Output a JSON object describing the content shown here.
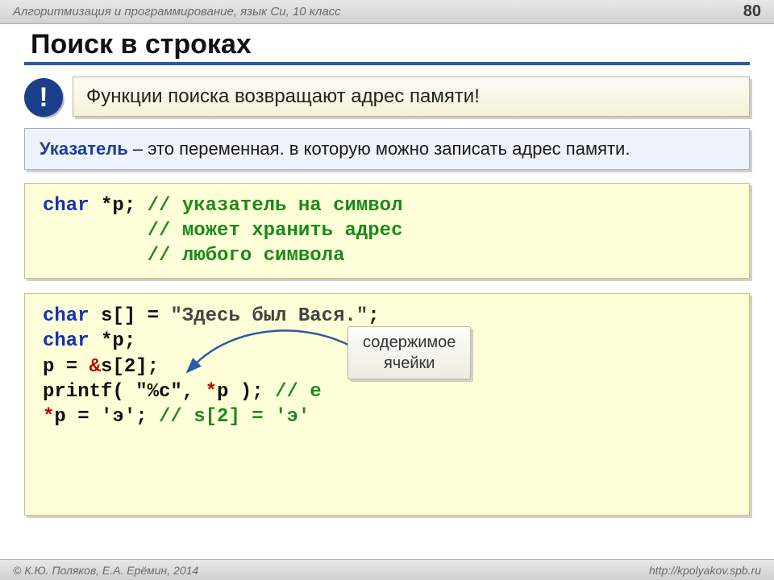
{
  "header": {
    "course_line": "Алгоритмизация и программирование, язык Си, 10 класс",
    "page_number": "80"
  },
  "title": "Поиск в строках",
  "note": {
    "badge": "!",
    "text": "Функции поиска возвращают адрес памяти!"
  },
  "definition": {
    "term": "Указатель",
    "rest": " – это переменная. в которую можно записать адрес памяти."
  },
  "code1": {
    "l1_kw": "char",
    "l1_rest": " *p; ",
    "l1_cm": "// указатель на символ",
    "l2_pad": "         ",
    "l2_cm": "// может хранить адрес",
    "l3_pad": "         ",
    "l3_cm": "// любого символа"
  },
  "code2": {
    "l1_kw": "char",
    "l1_mid": " s[] = ",
    "l1_str": "\"Здесь был Вася.\"",
    "l1_end": ";",
    "l2_kw": "char",
    "l2_rest": " *p;",
    "l3_a": "p = ",
    "l3_amp": "&",
    "l3_b": "s[2];",
    "l4_a": "printf( \"%c\", ",
    "l4_star": "*",
    "l4_b": "p ); ",
    "l4_cm": "// е",
    "l5_star": "*",
    "l5_a": "p = 'э'; ",
    "l5_cm": "// s[2] = 'э'",
    "callout": "содержимое\nячейки"
  },
  "footer": {
    "left": "© К.Ю. Поляков, Е.А. Ерёмин, 2014",
    "right": "http://kpolyakov.spb.ru"
  }
}
